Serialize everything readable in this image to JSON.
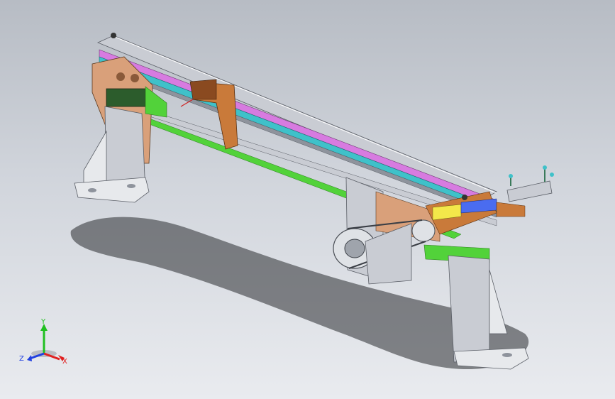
{
  "viewport": {
    "background_top": "#b7bcc4",
    "background_bottom": "#e9ebef"
  },
  "model": {
    "description_icon": "cad-conveyor-assembly",
    "colors": {
      "steel": "#c9ccd3",
      "steel_dark": "#8e939c",
      "magenta": "#d77be0",
      "cyan": "#3fc1c9",
      "green": "#52d23a",
      "copper": "#c97a3a",
      "tan": "#d9a07a",
      "blue": "#4a6cf0",
      "yellow": "#f3e84a"
    }
  },
  "triad": {
    "x_label": "X",
    "y_label": "Y",
    "z_label": "Z",
    "x_color": "#e02020",
    "y_color": "#20c020",
    "z_color": "#2040e0"
  }
}
